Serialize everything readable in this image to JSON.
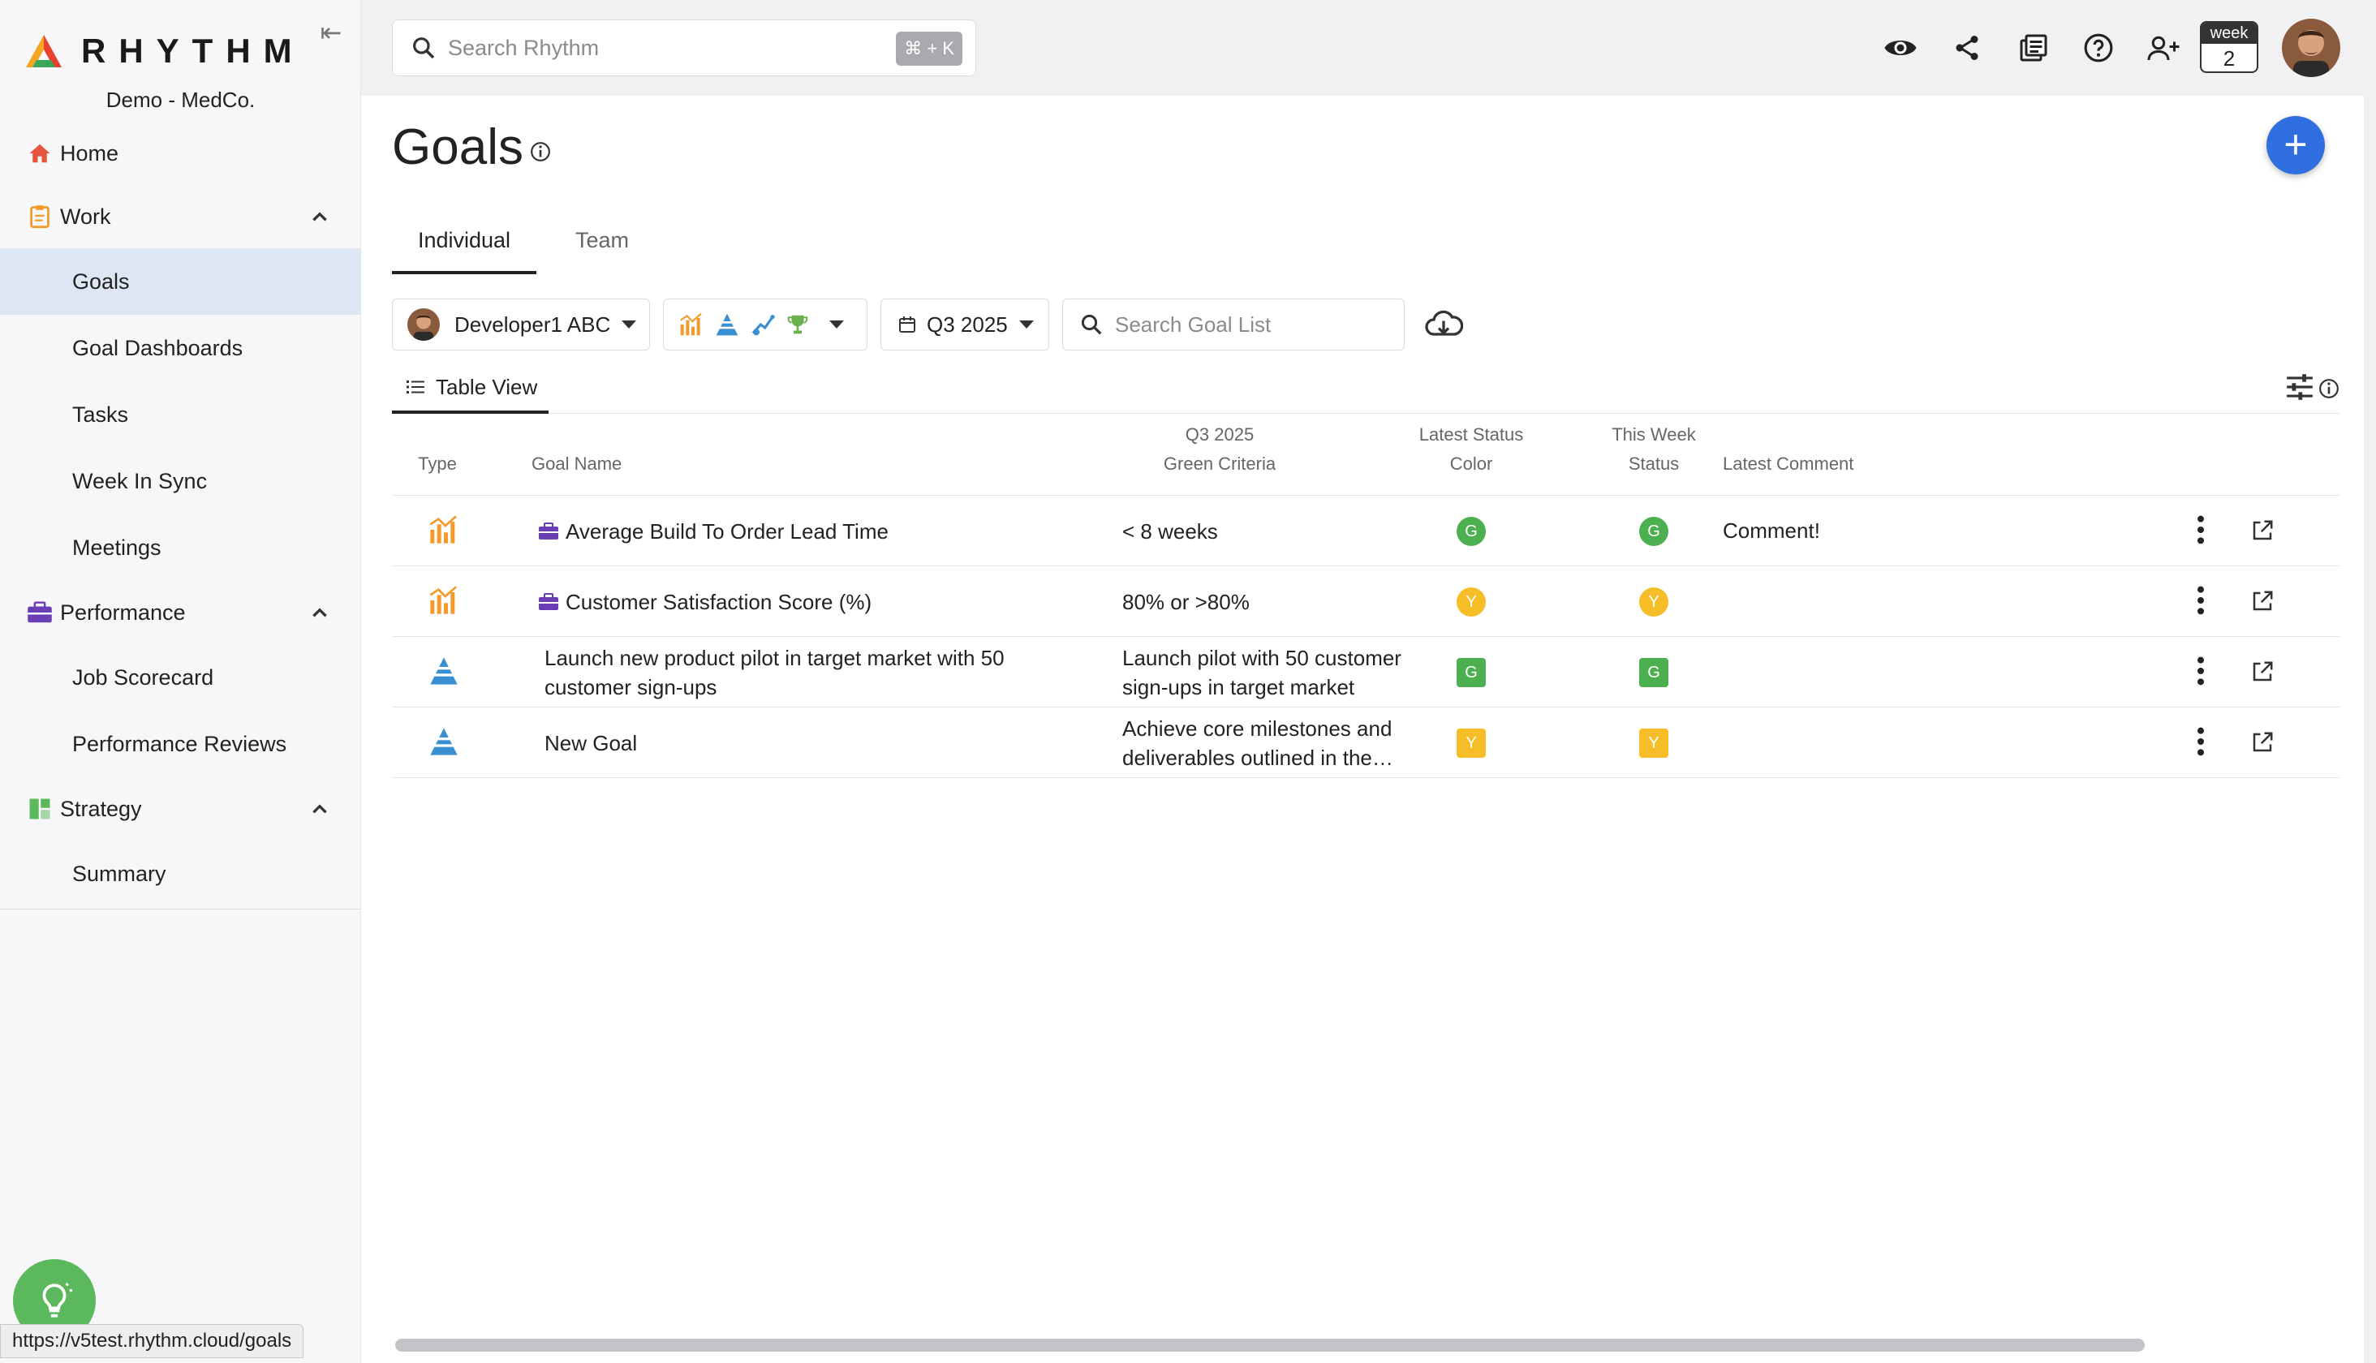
{
  "app": {
    "brand": "RHYTHM",
    "org": "Demo - MedCo."
  },
  "sidebar": {
    "collapse_glyph": "⇤",
    "sections": [
      {
        "label": "Home",
        "icon": "home-icon"
      },
      {
        "label": "Work",
        "icon": "clipboard-icon",
        "items": [
          "Goals",
          "Goal Dashboards",
          "Tasks",
          "Week In Sync",
          "Meetings"
        ]
      },
      {
        "label": "Performance",
        "icon": "briefcase-icon",
        "items": [
          "Job Scorecard",
          "Performance Reviews"
        ]
      },
      {
        "label": "Strategy",
        "icon": "dashboard-icon",
        "items": [
          "Summary"
        ]
      }
    ],
    "active_item": "Goals"
  },
  "topbar": {
    "search_placeholder": "Search Rhythm",
    "search_shortcut": "⌘ + K",
    "week_label": "week",
    "week_number": "2"
  },
  "page": {
    "title": "Goals",
    "add_label": "+",
    "tabs": [
      "Individual",
      "Team"
    ],
    "active_tab": "Individual"
  },
  "filters": {
    "person": "Developer1 ABC",
    "period": "Q3 2025",
    "goal_search_placeholder": "Search Goal List"
  },
  "view": {
    "label": "Table View"
  },
  "table": {
    "headers": {
      "type": "Type",
      "goal_name": "Goal Name",
      "criteria_line1": "Q3 2025",
      "criteria_line2": "Green Criteria",
      "latest_color_line1": "Latest Status",
      "latest_color_line2": "Color",
      "this_week_line1": "This Week",
      "this_week_line2": "Status",
      "latest_comment": "Latest Comment"
    },
    "rows": [
      {
        "type": "kpi",
        "name": "Average Build To Order Lead Time",
        "criteria": "< 8 weeks",
        "latest_color": "G",
        "this_week": "G",
        "comment": "Comment!",
        "shape": "circle",
        "color": "#4caf50"
      },
      {
        "type": "kpi",
        "name": "Customer Satisfaction Score (%)",
        "criteria": "80% or >80%",
        "latest_color": "Y",
        "this_week": "Y",
        "comment": "",
        "shape": "circle",
        "color": "#f5bd27"
      },
      {
        "type": "rock",
        "name": "Launch new product pilot in target market with 50 customer sign-ups",
        "criteria": "Launch pilot with 50 customer sign-ups in target market",
        "latest_color": "G",
        "this_week": "G",
        "comment": "",
        "shape": "square",
        "color": "#4caf50"
      },
      {
        "type": "rock",
        "name": "New Goal",
        "criteria": "Achieve core milestones and deliverables outlined in the plan",
        "latest_color": "Y",
        "this_week": "Y",
        "comment": "",
        "shape": "square",
        "color": "#f5bd27"
      }
    ]
  },
  "status_bar": {
    "url": "https://v5test.rhythm.cloud/goals"
  },
  "colors": {
    "accent": "#2f6fe0",
    "active_nav_bg": "#dde6f2",
    "green": "#4caf50",
    "yellow": "#f5bd27",
    "kpi_orange": "#f39a2b",
    "rock_blue": "#3a8fd0",
    "briefcase_purple": "#6a3fb5",
    "help_green": "#5cb85c"
  }
}
